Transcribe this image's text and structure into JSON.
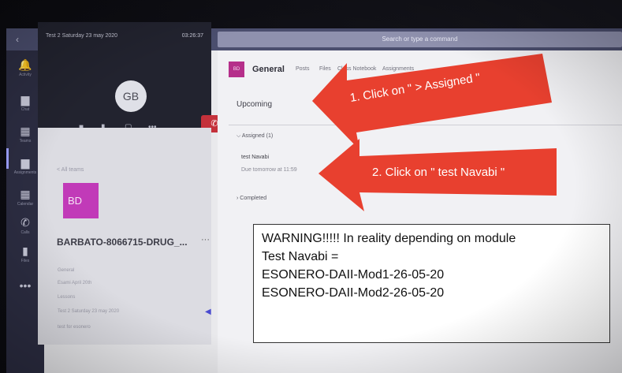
{
  "header": {
    "search_placeholder": "Search or type a command",
    "nav_arrows": "‹ ›",
    "compose_icon": "✎"
  },
  "rail": {
    "items": [
      {
        "label": "Activity",
        "icon": "bell-icon",
        "glyph": "🔔"
      },
      {
        "label": "Chat",
        "icon": "chat-icon",
        "glyph": "▆"
      },
      {
        "label": "Teams",
        "icon": "teams-icon",
        "glyph": "▦"
      },
      {
        "label": "Assignments",
        "icon": "backpack-icon",
        "glyph": "▆"
      },
      {
        "label": "Calendar",
        "icon": "calendar-icon",
        "glyph": "▦"
      },
      {
        "label": "Calls",
        "icon": "phone-icon",
        "glyph": "✆"
      },
      {
        "label": "Files",
        "icon": "file-icon",
        "glyph": "▮"
      },
      {
        "label": "",
        "icon": "more-icon",
        "glyph": "•••"
      }
    ]
  },
  "meeting": {
    "title": "Test 2 Saturday 23 may 2020",
    "time": "03:26:37",
    "avatar_initials": "GB"
  },
  "team": {
    "back_label": "< All teams",
    "tile_initials": "BD",
    "name": "BARBATO-8066715-DRUG_...",
    "more": "···",
    "channels": [
      "General",
      "Esami April 20th",
      "Lessons",
      "Test 2 Saturday 23 may 2020",
      "test for esonero"
    ]
  },
  "channel_header": {
    "tile": "BD",
    "title": "General",
    "tabs": [
      "Posts",
      "Files",
      "Class Notebook",
      "Assignments"
    ]
  },
  "assignments": {
    "upcoming_label": "Upcoming",
    "assigned_label": "Assigned (1)",
    "task_title": "test Navabi",
    "task_due": "Due tomorrow at 11:59",
    "completed_label": "Completed"
  },
  "annotations": {
    "arrow1_text": "1. Click on \" > Assigned \"",
    "arrow2_text": "2. Click on \" test Navabi \"",
    "arrow_color": "#e8402f",
    "warning_lines": [
      "WARNING!!!!! In reality depending on module",
      "Test Navabi =",
      "ESONERO-DAII-Mod1-26-05-20",
      "ESONERO-DAII-Mod2-26-05-20"
    ]
  }
}
